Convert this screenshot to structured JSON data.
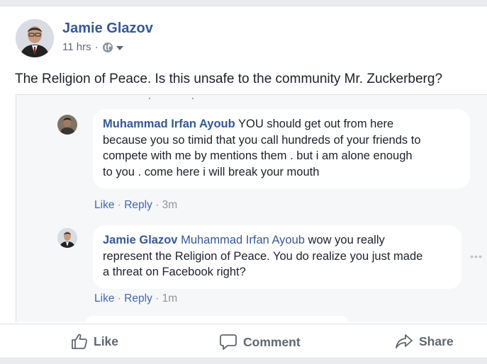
{
  "post": {
    "author": "Jamie Glazov",
    "time": "11 hrs",
    "separator": "·",
    "privacy_icon": "globe-icon",
    "text": "The Religion of Peace. Is this unsafe to the community Mr. Zuckerberg?"
  },
  "screenshot": {
    "comments": [
      {
        "name": "Muhammad Irfan Ayoub",
        "mention": "",
        "lines": [
          " YOU should get out from here",
          "because you so timid that you call hundreds of your friends to",
          "compete with me by mentions them . but i am alone enough",
          "to you . come here i will break your mouth"
        ],
        "like": "Like",
        "reply": "Reply",
        "time": "3m"
      },
      {
        "name": "Jamie Glazov",
        "mention": "Muhammad Irfan Ayoub",
        "lines": [
          " wow you really",
          "represent the Religion of Peace. You do realize you just made",
          "a threat on Facebook right?"
        ],
        "like": "Like",
        "reply": "Reply",
        "time": "1m"
      }
    ]
  },
  "actions": {
    "like": "Like",
    "comment": "Comment",
    "share": "Share"
  },
  "colors": {
    "link": "#365899",
    "action_link": "#4267b2",
    "text": "#1d2129",
    "muted": "#90949c"
  }
}
